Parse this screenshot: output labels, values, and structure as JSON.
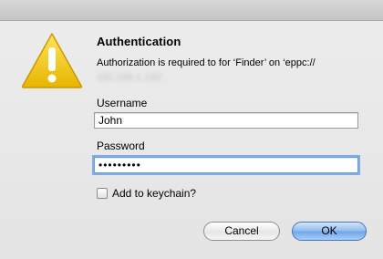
{
  "dialog": {
    "title": "Authentication",
    "message": "Authorization is required to for ‘Finder’ on ‘eppc://",
    "message_obscured": "192.168.1.132’.",
    "icon": "warning-icon"
  },
  "username": {
    "label": "Username",
    "value": "John"
  },
  "password": {
    "label": "Password",
    "value": "•••••••••"
  },
  "keychain": {
    "label": "Add to keychain?",
    "checked": false
  },
  "buttons": {
    "cancel": "Cancel",
    "ok": "OK"
  },
  "colors": {
    "warning_yellow": "#f2c20a",
    "focus_ring": "#7eaee8",
    "default_button": "#8fbaf0"
  }
}
